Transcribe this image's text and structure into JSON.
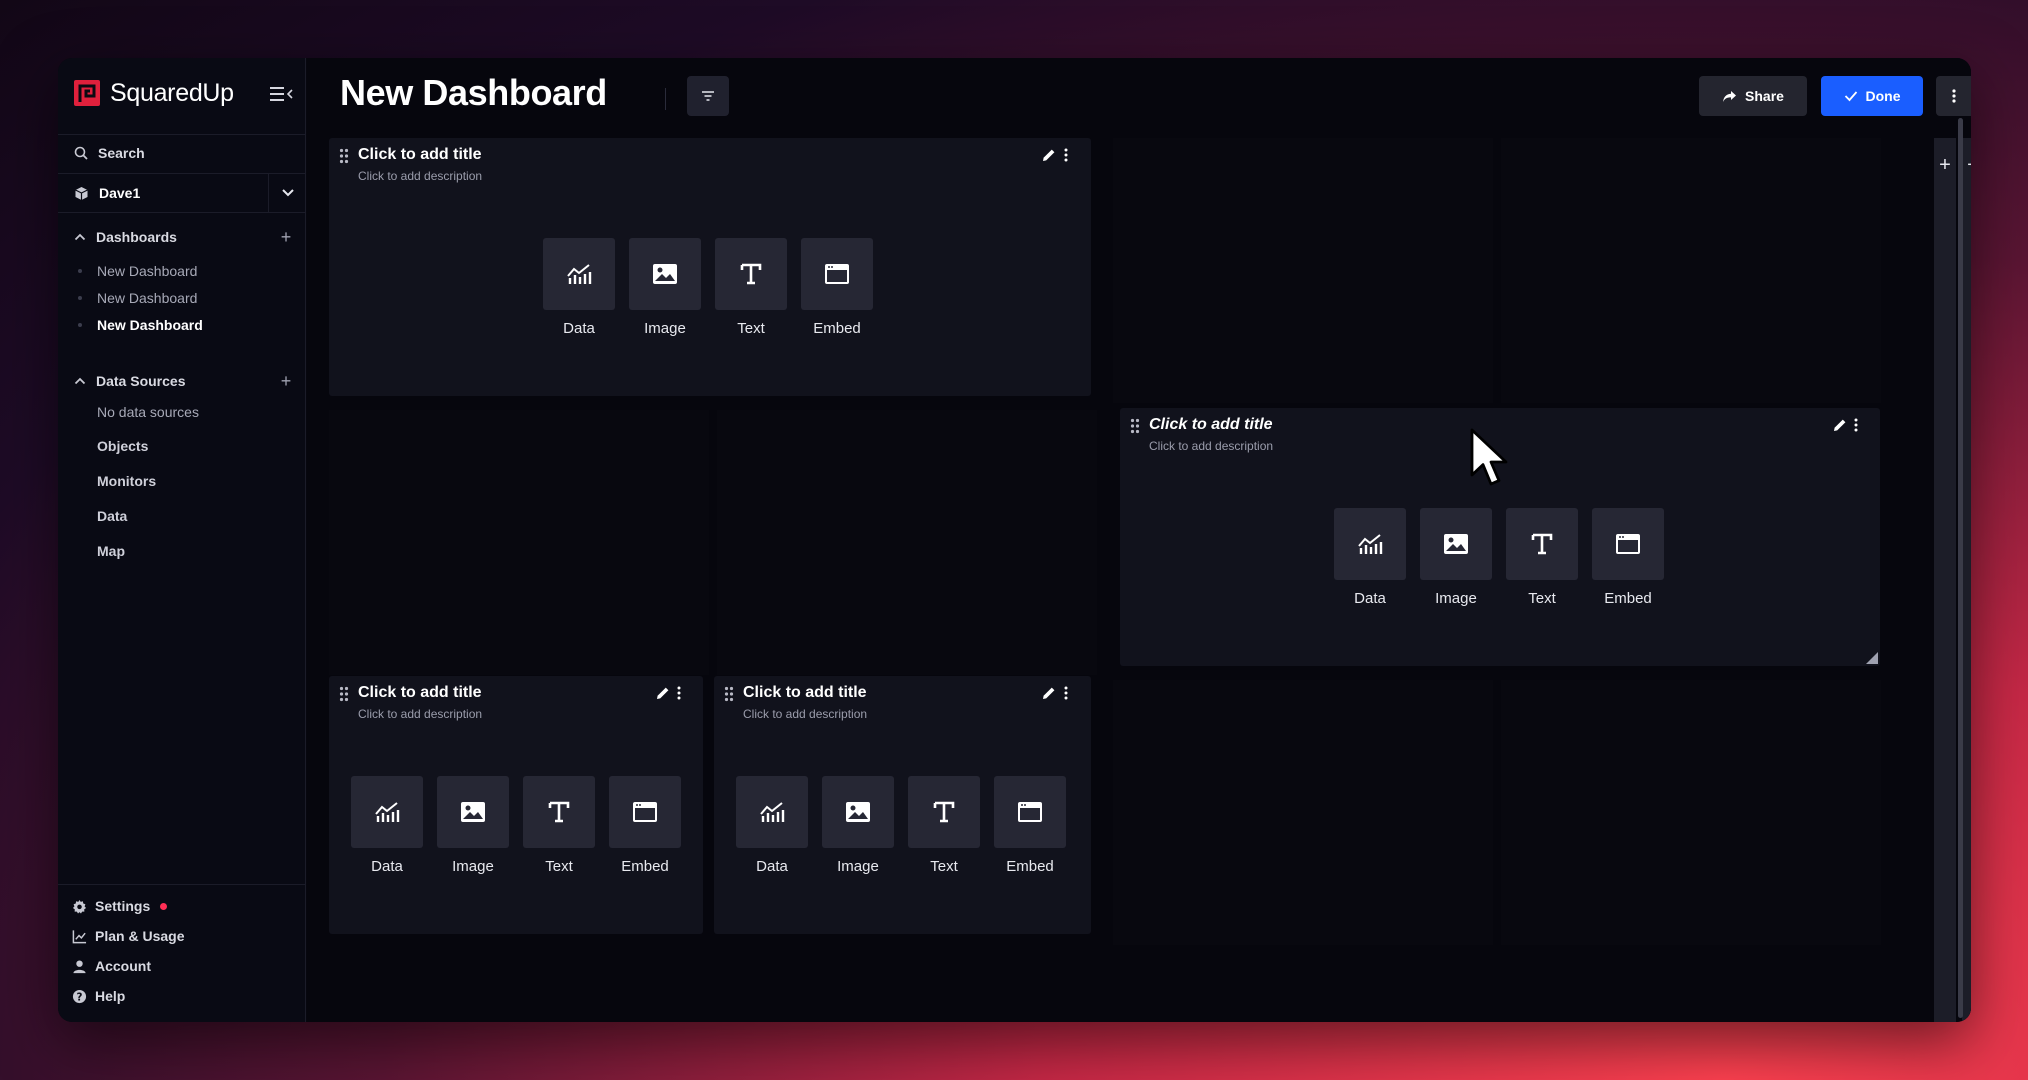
{
  "brand": {
    "name": "SquaredUp"
  },
  "sidebar": {
    "search_label": "Search",
    "workspace": "Dave1",
    "dashboards_label": "Dashboards",
    "dashboards": [
      {
        "label": "New Dashboard",
        "active": false
      },
      {
        "label": "New Dashboard",
        "active": false
      },
      {
        "label": "New Dashboard",
        "active": true
      }
    ],
    "data_sources_label": "Data Sources",
    "no_data_sources": "No data sources",
    "nav": [
      "Objects",
      "Monitors",
      "Data",
      "Map"
    ],
    "footer": [
      "Settings",
      "Plan & Usage",
      "Account",
      "Help"
    ]
  },
  "header": {
    "title": "New Dashboard",
    "share_label": "Share",
    "done_label": "Done"
  },
  "tiles": [
    {
      "title": "Click to add title",
      "description": "Click to add description"
    },
    {
      "title": "Click to add title",
      "description": "Click to add description"
    },
    {
      "title": "Click to add title",
      "description": "Click to add description"
    },
    {
      "title": "Click to add title",
      "description": "Click to add description"
    }
  ],
  "tile_options": [
    "Data",
    "Image",
    "Text",
    "Embed"
  ],
  "zoom": {
    "in_label": "+",
    "out_label": "−"
  },
  "colors": {
    "accent": "#1a5eff",
    "brand": "#e0203c",
    "notification": "#ff2e55"
  }
}
